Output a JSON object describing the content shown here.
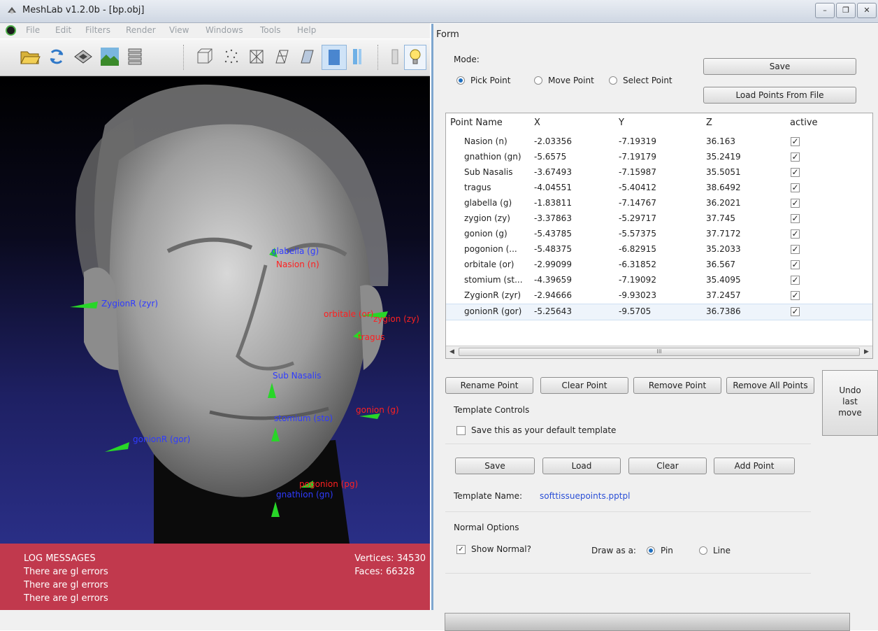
{
  "window": {
    "title": "MeshLab v1.2.0b - [bp.obj]",
    "min": "–",
    "max": "❐",
    "close": "✕"
  },
  "menu": [
    "File",
    "Edit",
    "Filters",
    "Render",
    "View",
    "Windows",
    "Tools",
    "Help"
  ],
  "toolbar_icons": [
    "open-folder-icon",
    "reload-icon",
    "export-icon",
    "snapshot-icon",
    "layers-icon",
    "bbox-icon",
    "points-icon",
    "wireframe-icon",
    "hidden-lines-icon",
    "flat-icon",
    "smooth-icon",
    "texture-icon",
    "light-icon",
    "lightbulb-icon"
  ],
  "viewport": {
    "log_title": "LOG MESSAGES",
    "log_lines": [
      "There are gl errors",
      "There are gl errors",
      "There are gl errors"
    ],
    "vertices": "Vertices: 34530",
    "faces": "Faces: 66328",
    "labels": [
      {
        "text": "glabella (g)",
        "color": "blue"
      },
      {
        "text": "Nasion (n)",
        "color": "red"
      },
      {
        "text": "ZygionR (zyr)",
        "color": "blue"
      },
      {
        "text": "orbitale (or)",
        "color": "red"
      },
      {
        "text": "zygion (zy)",
        "color": "red"
      },
      {
        "text": "tragus",
        "color": "red"
      },
      {
        "text": "Sub Nasalis",
        "color": "blue"
      },
      {
        "text": "gonion (g)",
        "color": "red"
      },
      {
        "text": "stomium (sto)",
        "color": "blue"
      },
      {
        "text": "gonionR (gor)",
        "color": "blue"
      },
      {
        "text": "pogonion (pg)",
        "color": "red"
      },
      {
        "text": "gnathion (gn)",
        "color": "blue"
      }
    ]
  },
  "form": {
    "title": "Form",
    "mode_label": "Mode:",
    "modes": [
      "Pick Point",
      "Move Point",
      "Select Point"
    ],
    "selected_mode": "Pick Point",
    "save_label": "Save",
    "load_points_label": "Load Points From File",
    "columns": [
      "Point Name",
      "X",
      "Y",
      "Z",
      "active"
    ],
    "rows": [
      {
        "name": "Nasion (n)",
        "x": "-2.03356",
        "y": "-7.19319",
        "z": "36.163",
        "active": true
      },
      {
        "name": "gnathion (gn)",
        "x": "-5.6575",
        "y": "-7.19179",
        "z": "35.2419",
        "active": true
      },
      {
        "name": "Sub Nasalis",
        "x": "-3.67493",
        "y": "-7.15987",
        "z": "35.5051",
        "active": true
      },
      {
        "name": "tragus",
        "x": "-4.04551",
        "y": "-5.40412",
        "z": "38.6492",
        "active": true
      },
      {
        "name": "glabella (g)",
        "x": "-1.83811",
        "y": "-7.14767",
        "z": "36.2021",
        "active": true
      },
      {
        "name": "zygion (zy)",
        "x": "-3.37863",
        "y": "-5.29717",
        "z": "37.745",
        "active": true
      },
      {
        "name": "gonion (g)",
        "x": "-5.43785",
        "y": "-5.57375",
        "z": "37.7172",
        "active": true
      },
      {
        "name": "pogonion (...",
        "x": "-5.48375",
        "y": "-6.82915",
        "z": "35.2033",
        "active": true
      },
      {
        "name": "orbitale (or)",
        "x": "-2.99099",
        "y": "-6.31852",
        "z": "36.567",
        "active": true
      },
      {
        "name": "stomium (st...",
        "x": "-4.39659",
        "y": "-7.19092",
        "z": "35.4095",
        "active": true
      },
      {
        "name": "ZygionR (zyr)",
        "x": "-2.94666",
        "y": "-9.93023",
        "z": "37.2457",
        "active": true
      },
      {
        "name": "gonionR (gor)",
        "x": "-5.25643",
        "y": "-9.5705",
        "z": "36.7386",
        "active": true
      }
    ],
    "selected_row": "gonionR (gor)",
    "scroll_thumb": "III",
    "rename_point": "Rename Point",
    "clear_point": "Clear Point",
    "remove_point": "Remove Point",
    "remove_all_points": "Remove All Points",
    "undo_label": [
      "Undo",
      "last",
      "move"
    ],
    "template_controls": "Template Controls",
    "save_default_template": "Save this as your default template",
    "save_default_checked": false,
    "template_save": "Save",
    "template_load": "Load",
    "template_clear": "Clear",
    "add_point": "Add Point",
    "template_name_label": "Template Name:",
    "template_name_value": "softtissuepoints.pptpl",
    "normal_options": "Normal Options",
    "show_normal": "Show Normal?",
    "show_normal_checked": true,
    "draw_as_label": "Draw as a:",
    "draw_as_options": [
      "Pin",
      "Line"
    ],
    "draw_as_selected": "Pin"
  }
}
